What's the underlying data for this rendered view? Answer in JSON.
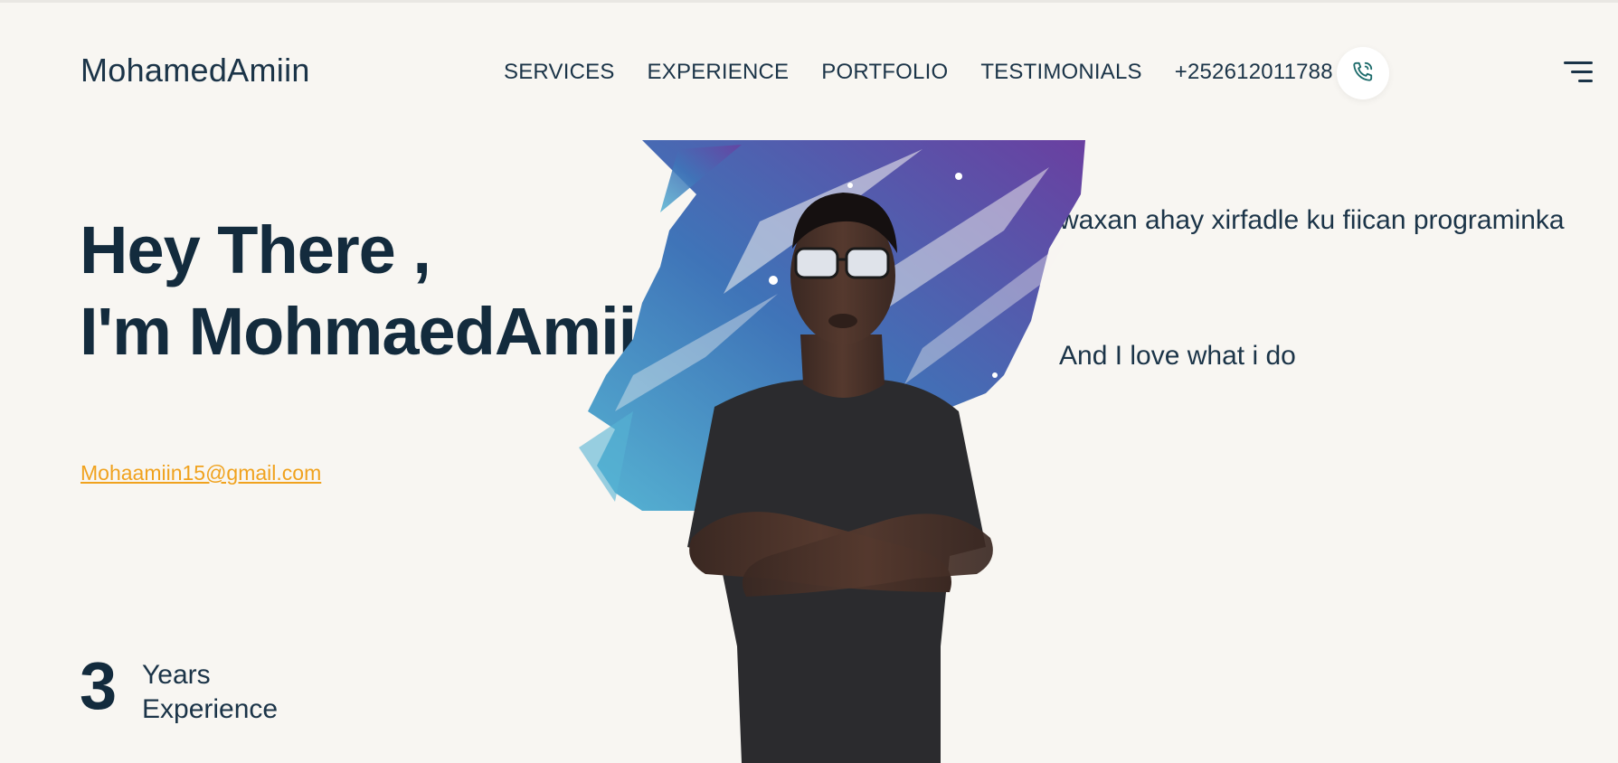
{
  "header": {
    "brand": "MohamedAmiin",
    "nav": [
      "SERVICES",
      "EXPERIENCE",
      "PORTFOLIO",
      "TESTIMONIALS"
    ],
    "phone": "+252612011788",
    "call_icon": "phone-icon",
    "menu_icon": "hamburger-menu-icon"
  },
  "hero": {
    "greeting_line1": "Hey There ,",
    "greeting_line2": "I'm MohmaedAmiin.",
    "email": "Mohaamiin15@gmail.com",
    "experience_number": "3",
    "experience_label_line1": "Years",
    "experience_label_line2": "Experience",
    "tagline1": "waxan ahay xirfadle ku fiican programinka",
    "tagline2": "And I love what i do"
  },
  "colors": {
    "background": "#f8f6f2",
    "text": "#132b3d",
    "link": "#f0a21e",
    "brush_start": "#56b4d3",
    "brush_end": "#6a3fa0"
  }
}
